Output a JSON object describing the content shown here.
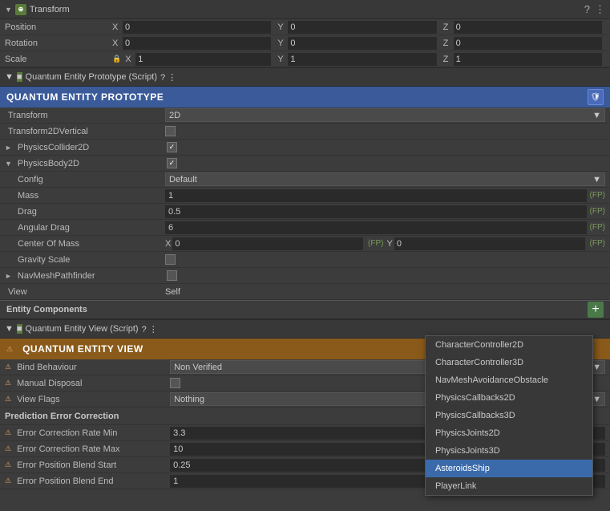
{
  "transform": {
    "header_title": "Transform",
    "position": {
      "label": "Position",
      "x": "0",
      "y": "0",
      "z": "0"
    },
    "rotation": {
      "label": "Rotation",
      "x": "0",
      "y": "0",
      "z": "0"
    },
    "scale": {
      "label": "Scale",
      "x": "1",
      "y": "1",
      "z": "1"
    }
  },
  "quantum_entity_prototype": {
    "script_label": "Quantum Entity Prototype (Script)",
    "header_title": "QUANTUM ENTITY PROTOTYPE",
    "rows": [
      {
        "label": "Transform",
        "value": "2D",
        "type": "dropdown"
      },
      {
        "label": "Transform2DVertical",
        "value": "",
        "type": "checkbox",
        "checked": false
      },
      {
        "label": "PhysicsCollider2D",
        "value": "",
        "type": "checkbox",
        "checked": true,
        "arrow": true
      },
      {
        "label": "PhysicsBody2D",
        "value": "",
        "type": "checkbox",
        "checked": true,
        "arrow": true
      },
      {
        "label": "Config",
        "value": "Default",
        "type": "dropdown",
        "indented": true
      },
      {
        "label": "Mass",
        "value": "1",
        "type": "fp",
        "indented": true
      },
      {
        "label": "Drag",
        "value": "0.5",
        "type": "fp",
        "indented": true
      },
      {
        "label": "Angular Drag",
        "value": "6",
        "type": "fp",
        "indented": true
      },
      {
        "label": "Center Of Mass",
        "value": "",
        "type": "xy",
        "x": "0",
        "y": "0",
        "indented": true
      },
      {
        "label": "Gravity Scale",
        "value": "",
        "type": "checkbox",
        "checked": false,
        "indented": true
      },
      {
        "label": "NavMeshPathfinder",
        "value": "",
        "type": "checkbox",
        "checked": false,
        "arrow": true
      },
      {
        "label": "View",
        "value": "Self",
        "type": "text"
      }
    ],
    "entity_components_label": "Entity Components",
    "add_btn": "+"
  },
  "quantum_entity_view": {
    "script_label": "Quantum Entity View (Script)",
    "header_title": "QUANTUM ENTITY VIEW",
    "rows": [
      {
        "label": "Bind Behaviour",
        "value": "Non Verified",
        "type": "dropdown"
      },
      {
        "label": "Manual Disposal",
        "value": "",
        "type": "checkbox",
        "checked": false
      },
      {
        "label": "View Flags",
        "value": "Nothing",
        "type": "dropdown"
      }
    ],
    "prediction_section": {
      "title": "Prediction Error Correction",
      "rows": [
        {
          "label": "Error Correction Rate Min",
          "value": "3.3"
        },
        {
          "label": "Error Correction Rate Max",
          "value": "10"
        },
        {
          "label": "Error Position Blend Start",
          "value": "0.25"
        },
        {
          "label": "Error Position Blend End",
          "value": "1"
        }
      ]
    }
  },
  "dropdown_menu": {
    "items": [
      {
        "label": "CharacterController2D",
        "selected": false
      },
      {
        "label": "CharacterController3D",
        "selected": false
      },
      {
        "label": "NavMeshAvoidanceObstacle",
        "selected": false
      },
      {
        "label": "PhysicsCallbacks2D",
        "selected": false
      },
      {
        "label": "PhysicsCallbacks3D",
        "selected": false
      },
      {
        "label": "PhysicsJoints2D",
        "selected": false
      },
      {
        "label": "PhysicsJoints3D",
        "selected": false
      },
      {
        "label": "AsteroidsShip",
        "selected": true
      },
      {
        "label": "PlayerLink",
        "selected": false
      }
    ]
  },
  "icons": {
    "fold_down": "▼",
    "fold_right": "►",
    "question": "?",
    "settings": "⋮",
    "add": "+",
    "lock": "🔒",
    "shield": "🛡"
  }
}
